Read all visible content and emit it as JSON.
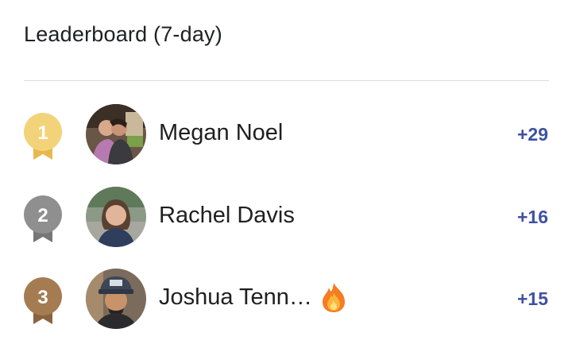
{
  "header": {
    "title": "Leaderboard (7-day)"
  },
  "entries": [
    {
      "rank": "1",
      "name": "Megan Noel",
      "score": "+29",
      "medal_color": "#f3d37a",
      "medal_ribbon": "#e7b84b",
      "streak_icon": ""
    },
    {
      "rank": "2",
      "name": "Rachel Davis",
      "score": "+16",
      "medal_color": "#8f8f8f",
      "medal_ribbon": "#767676",
      "streak_icon": ""
    },
    {
      "rank": "3",
      "name": "Joshua Tenn…",
      "score": "+15",
      "medal_color": "#a57c52",
      "medal_ribbon": "#8a6440",
      "streak_icon": "fire-icon"
    }
  ],
  "colors": {
    "score": "#3f51a3",
    "divider": "#dcdcdc"
  }
}
